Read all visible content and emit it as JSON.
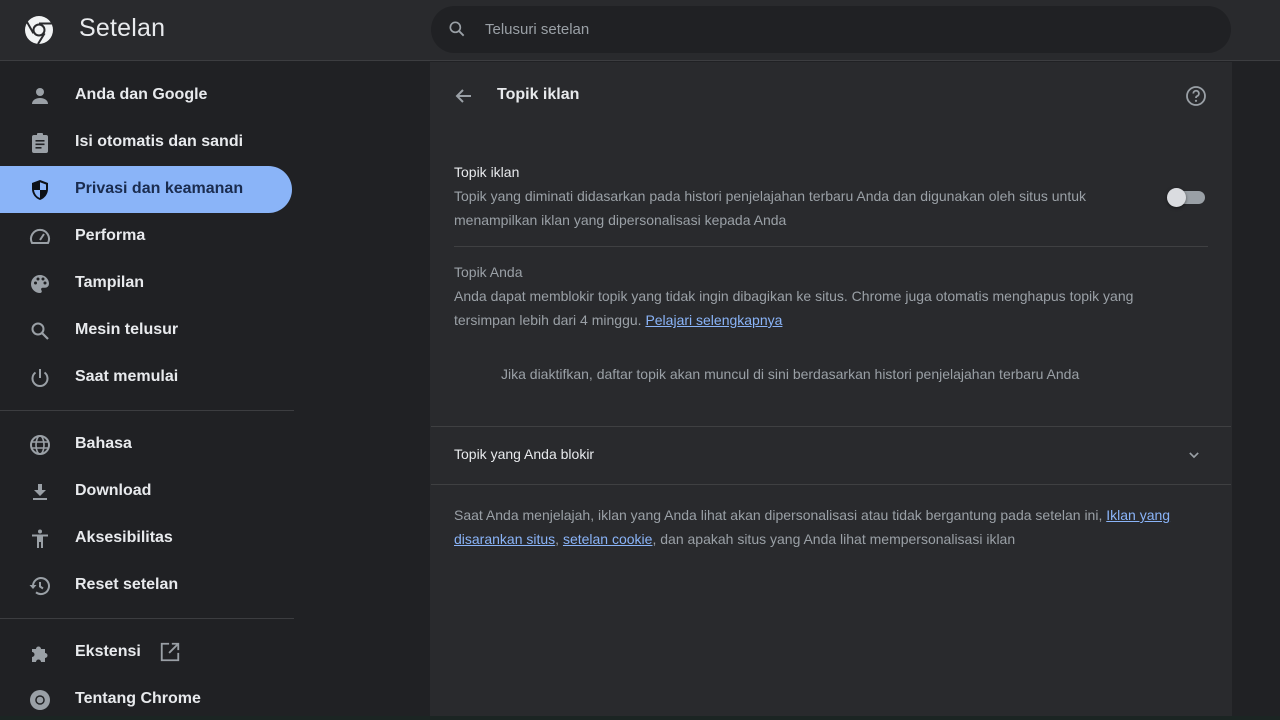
{
  "header": {
    "app_title": "Setelan",
    "search_placeholder": "Telusuri setelan",
    "search_value": ""
  },
  "sidebar": {
    "items": [
      {
        "label": "Anda dan Google",
        "icon": "person-icon",
        "active": false
      },
      {
        "label": "Isi otomatis dan sandi",
        "icon": "clipboard-icon",
        "active": false
      },
      {
        "label": "Privasi dan keamanan",
        "icon": "shield-icon",
        "active": true
      },
      {
        "label": "Performa",
        "icon": "speedometer-icon",
        "active": false
      },
      {
        "label": "Tampilan",
        "icon": "palette-icon",
        "active": false
      },
      {
        "label": "Mesin telusur",
        "icon": "search-icon",
        "active": false
      },
      {
        "label": "Saat memulai",
        "icon": "power-icon",
        "active": false
      },
      {
        "label": "Bahasa",
        "icon": "globe-icon",
        "active": false
      },
      {
        "label": "Download",
        "icon": "download-icon",
        "active": false
      },
      {
        "label": "Aksesibilitas",
        "icon": "accessibility-icon",
        "active": false
      },
      {
        "label": "Reset setelan",
        "icon": "history-icon",
        "active": false
      },
      {
        "label": "Ekstensi",
        "icon": "puzzle-icon",
        "active": false,
        "external": true
      },
      {
        "label": "Tentang Chrome",
        "icon": "chrome-icon",
        "active": false
      }
    ]
  },
  "page": {
    "title": "Topik iklan",
    "ad_topics": {
      "title": "Topik iklan",
      "description": "Topik yang diminati didasarkan pada histori penjelajahan terbaru Anda dan digunakan oleh situs untuk menampilkan iklan yang dipersonalisasi kepada Anda",
      "enabled": false
    },
    "your_topics": {
      "title": "Topik Anda",
      "description": "Anda dapat memblokir topik yang tidak ingin dibagikan ke situs. Chrome juga otomatis menghapus topik yang tersimpan lebih dari 4 minggu. ",
      "link": "Pelajari selengkapnya",
      "empty_message": "Jika diaktifkan, daftar topik akan muncul di sini berdasarkan histori penjelajahan terbaru Anda"
    },
    "blocked_topics": {
      "label": "Topik yang Anda blokir",
      "expanded": false
    },
    "footer": {
      "text_before": "Saat Anda menjelajah, iklan yang Anda lihat akan dipersonalisasi atau tidak bergantung pada setelan ini, ",
      "link1": "Iklan yang disarankan situs",
      "sep": ", ",
      "link2": "setelan cookie",
      "text_after": ", dan apakah situs yang Anda lihat mempersonalisasi iklan"
    }
  },
  "colors": {
    "accent": "#8ab4f8",
    "background": "#202124",
    "surface": "#292a2d",
    "text_primary": "#e8eaed",
    "text_secondary": "#9aa0a6"
  }
}
